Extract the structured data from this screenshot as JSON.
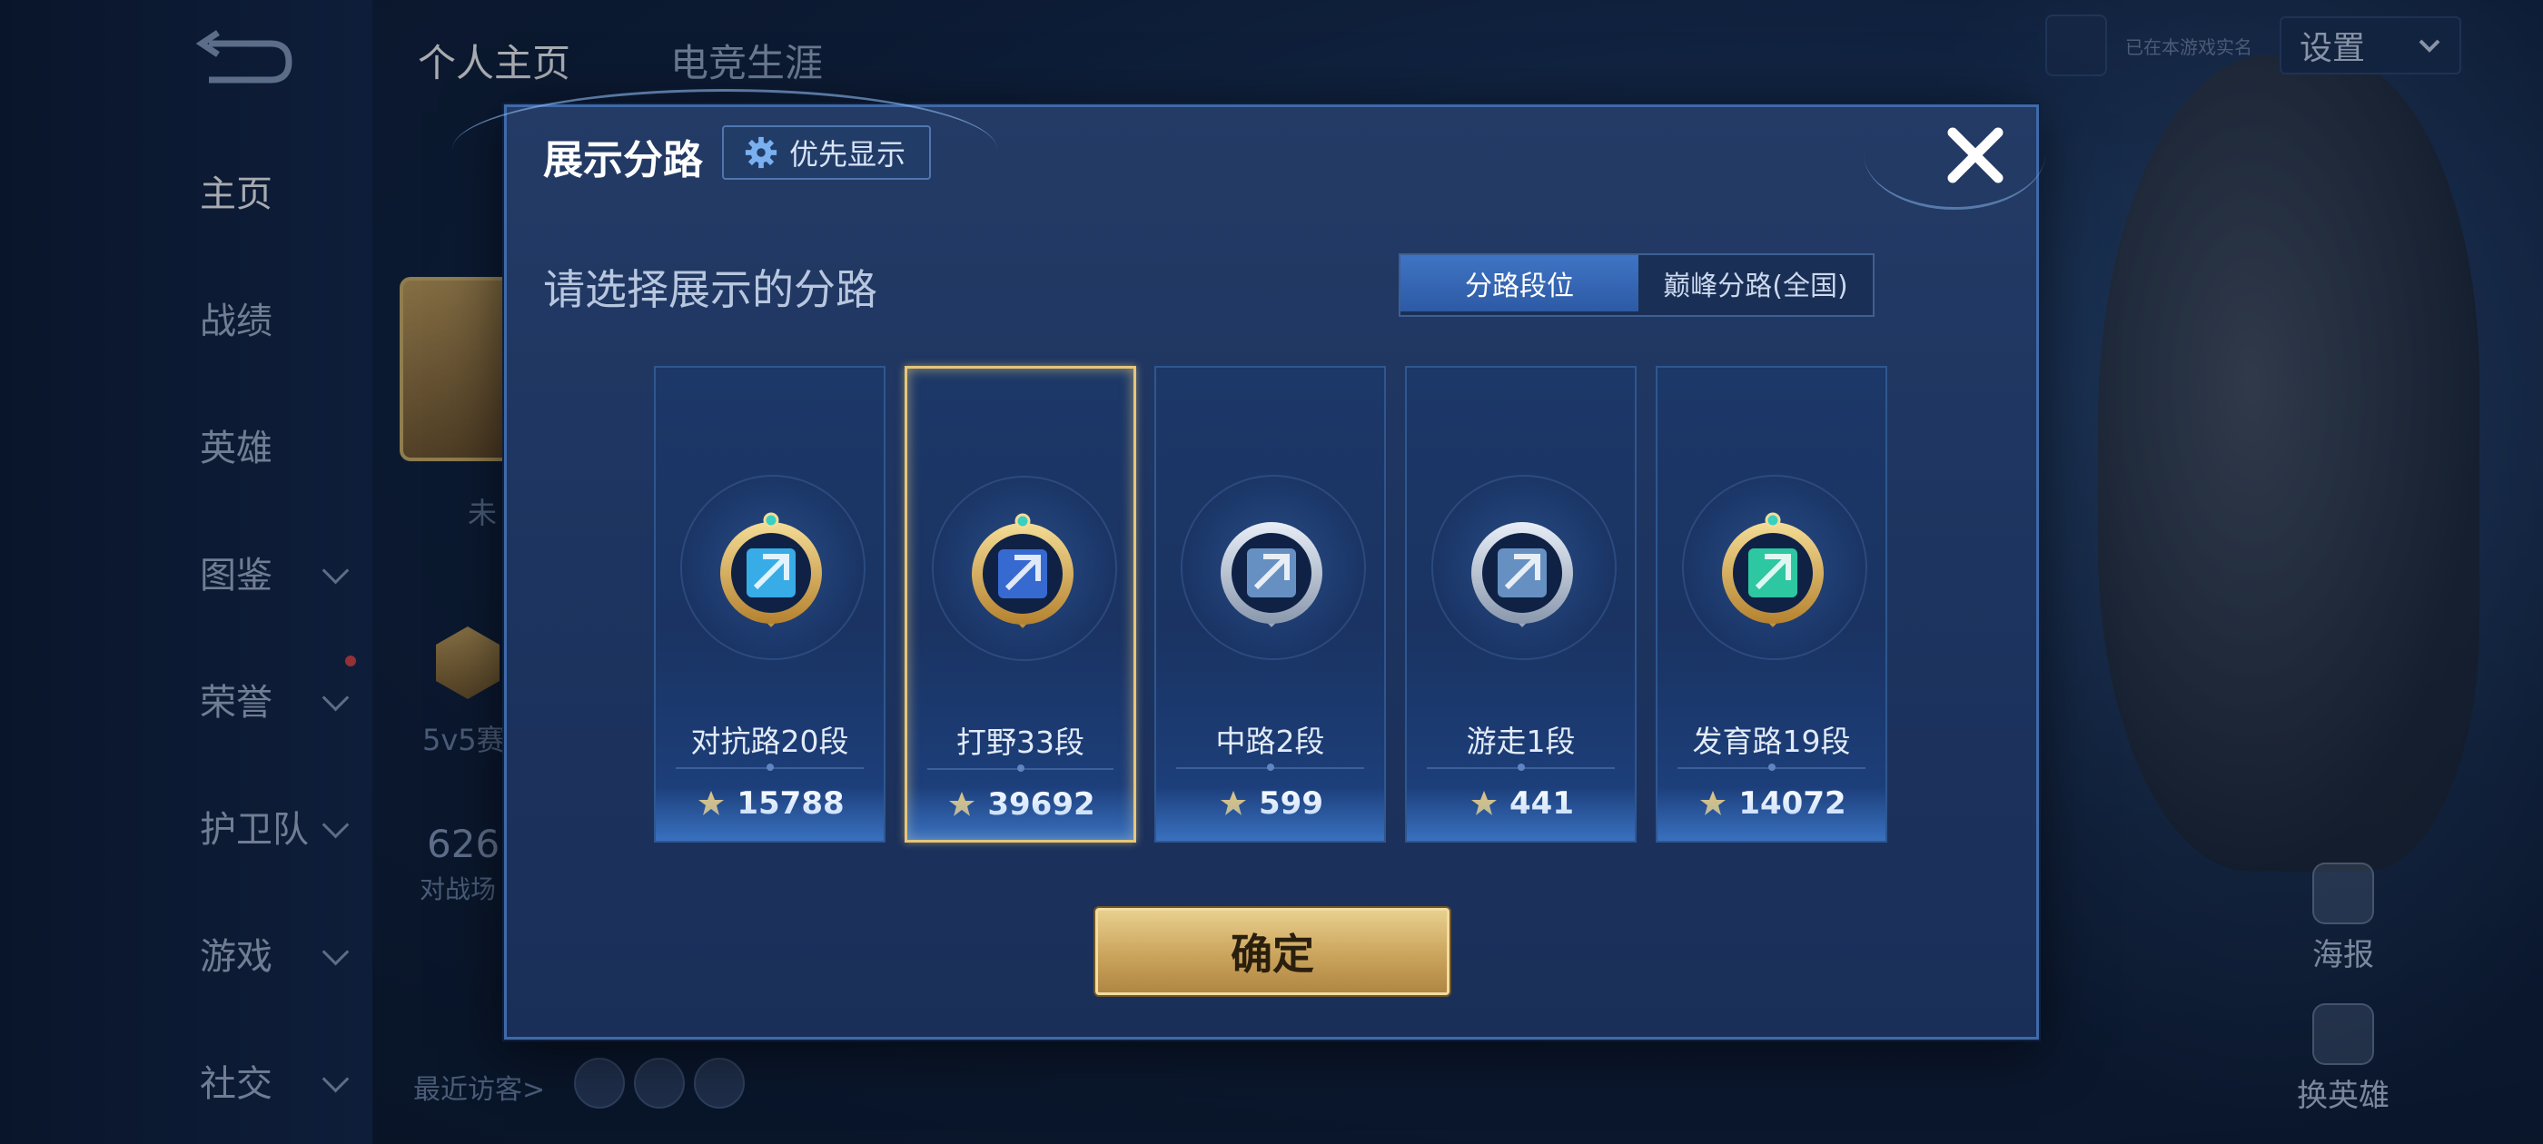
{
  "background": {
    "top_tabs": [
      "个人主页",
      "电竞生涯"
    ],
    "sidebar": [
      {
        "label": "主页",
        "active": true,
        "chevron": false
      },
      {
        "label": "战绩",
        "active": false,
        "chevron": false
      },
      {
        "label": "英雄",
        "active": false,
        "chevron": false
      },
      {
        "label": "图鉴",
        "active": false,
        "chevron": true
      },
      {
        "label": "荣誉",
        "active": false,
        "chevron": true
      },
      {
        "label": "护卫队",
        "active": false,
        "chevron": true
      },
      {
        "label": "游戏",
        "active": false,
        "chevron": true
      },
      {
        "label": "社交",
        "active": false,
        "chevron": true
      }
    ],
    "settings_label": "设置",
    "realname_hint": "已在本游戏实名",
    "partial_texts": {
      "status": "未",
      "mode": "5v5赛",
      "number": "626",
      "battle": "对战场",
      "recent_visitors": "最近访客>"
    },
    "right_buttons": [
      {
        "label": "海报",
        "icon": "poster-icon"
      },
      {
        "label": "换英雄",
        "icon": "swap-hero-icon"
      }
    ]
  },
  "dialog": {
    "title": "展示分路",
    "priority_button": "优先显示",
    "subtitle": "请选择展示的分路",
    "segment": {
      "options": [
        "分路段位",
        "巅峰分路(全国)"
      ],
      "selected": 0
    },
    "cards": [
      {
        "name": "对抗路20段",
        "score": "15788",
        "badge": "clash-lane-badge",
        "selected": false,
        "accent": "#3bb4f0",
        "rim": "gold"
      },
      {
        "name": "打野33段",
        "score": "39692",
        "badge": "jungle-badge",
        "selected": true,
        "accent": "#3a6fd8",
        "rim": "gold"
      },
      {
        "name": "中路2段",
        "score": "599",
        "badge": "mid-lane-badge",
        "selected": false,
        "accent": "#6d97c9",
        "rim": "silver"
      },
      {
        "name": "游走1段",
        "score": "441",
        "badge": "roam-badge",
        "selected": false,
        "accent": "#6d97c9",
        "rim": "silver"
      },
      {
        "name": "发育路19段",
        "score": "14072",
        "badge": "farm-lane-badge",
        "selected": false,
        "accent": "#2fd1a8",
        "rim": "gold"
      }
    ],
    "confirm_label": "确定"
  }
}
